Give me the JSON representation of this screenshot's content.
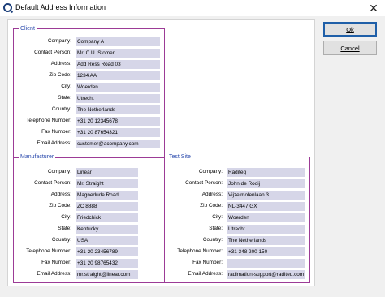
{
  "window": {
    "title": "Default Address Information",
    "close_glyph": "✕"
  },
  "buttons": {
    "ok": "Ok",
    "cancel": "Cancel"
  },
  "client": {
    "title": "Client",
    "fields": [
      {
        "label": "Company:",
        "value": "Company A"
      },
      {
        "label": "Contact Person:",
        "value": "Mr. C.U. Stomer"
      },
      {
        "label": "Address:",
        "value": "Add Ress Road 03"
      },
      {
        "label": "Zip Code:",
        "value": "1234 AA"
      },
      {
        "label": "City:",
        "value": "Woerden"
      },
      {
        "label": "State:",
        "value": "Utrecht"
      },
      {
        "label": "Country:",
        "value": "The Netherlands"
      },
      {
        "label": "Telephone Number:",
        "value": "+31 20 12345678"
      },
      {
        "label": "Fax Number:",
        "value": "+31 20 87654321"
      },
      {
        "label": "Email Address:",
        "value": "customer@acompany.com"
      }
    ]
  },
  "manufacturer": {
    "title": "Manufacturer",
    "fields": [
      {
        "label": "Company:",
        "value": "Linear"
      },
      {
        "label": "Contact Person:",
        "value": "Mr. Straight"
      },
      {
        "label": "Address:",
        "value": "Magnedude Road"
      },
      {
        "label": "Zip Code:",
        "value": "ZC 8888"
      },
      {
        "label": "City:",
        "value": "Friedchick"
      },
      {
        "label": "State:",
        "value": "Kentucky"
      },
      {
        "label": "Country:",
        "value": "USA"
      },
      {
        "label": "Telephone Number:",
        "value": "+31 20 23456789"
      },
      {
        "label": "Fax Number:",
        "value": "+31 20 98765432"
      },
      {
        "label": "Email Address:",
        "value": "mr.straight@linear.com"
      }
    ]
  },
  "test_site": {
    "title": "Test Site",
    "fields": [
      {
        "label": "Company:",
        "value": "Raditeq"
      },
      {
        "label": "Contact Person:",
        "value": "John de Rooij"
      },
      {
        "label": "Address:",
        "value": "Vijzelmolenlaan 3"
      },
      {
        "label": "Zip Code:",
        "value": "NL-3447 GX"
      },
      {
        "label": "City:",
        "value": "Woerden"
      },
      {
        "label": "State:",
        "value": "Utrecht"
      },
      {
        "label": "Country:",
        "value": "The Netherlands"
      },
      {
        "label": "Telephone Number:",
        "value": "+31 348 200 150"
      },
      {
        "label": "Fax Number:",
        "value": ""
      },
      {
        "label": "Email Address:",
        "value": "radimation-support@raditeq.com"
      }
    ]
  }
}
